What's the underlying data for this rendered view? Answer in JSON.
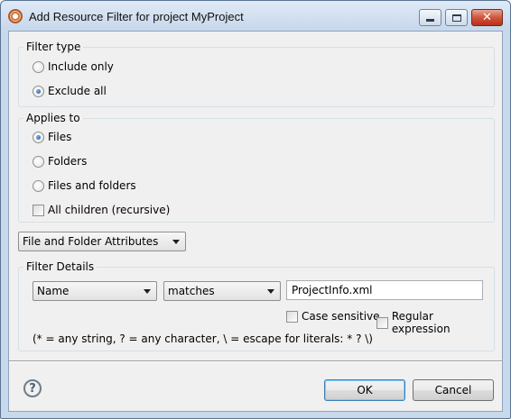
{
  "window": {
    "title": "Add Resource Filter for project MyProject",
    "close_glyph": "✕"
  },
  "filter_type": {
    "legend": "Filter type",
    "options": [
      {
        "label": "Include only",
        "selected": false
      },
      {
        "label": "Exclude all",
        "selected": true
      }
    ]
  },
  "applies_to": {
    "legend": "Applies to",
    "options": [
      {
        "label": "Files",
        "selected": true
      },
      {
        "label": "Folders",
        "selected": false
      },
      {
        "label": "Files and folders",
        "selected": false
      }
    ],
    "recursive": {
      "label": "All children (recursive)",
      "checked": false
    }
  },
  "attributes_combo": {
    "value": "File and Folder Attributes"
  },
  "filter_details": {
    "legend": "Filter Details",
    "attribute_combo": "Name",
    "operator_combo": "matches",
    "value": "ProjectInfo.xml",
    "case_sensitive": {
      "label": "Case sensitive",
      "checked": false
    },
    "regex": {
      "label": "Regular expression",
      "checked": false
    },
    "hint": "(* = any string, ? = any character, \\ = escape for literals: * ? \\)"
  },
  "footer": {
    "help_glyph": "?",
    "ok_label": "OK",
    "cancel_label": "Cancel"
  },
  "colors": {
    "title_gradient": "#c9d9ec",
    "client_bg": "#f0f0f0",
    "default_button_border": "#3c7fb1"
  }
}
